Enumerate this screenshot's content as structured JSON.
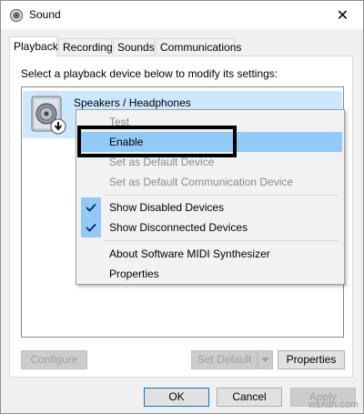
{
  "window": {
    "title": "Sound",
    "close_label": "✕"
  },
  "tabs": [
    {
      "label": "Playback",
      "active": true
    },
    {
      "label": "Recording",
      "active": false
    },
    {
      "label": "Sounds",
      "active": false
    },
    {
      "label": "Communications",
      "active": false
    }
  ],
  "playback": {
    "instruction": "Select a playback device below to modify its settings:",
    "devices": [
      {
        "name": "Speakers / Headphones",
        "icon": "speaker-icon",
        "status_icon": "down-arrow-icon"
      }
    ]
  },
  "context_menu": {
    "items": [
      {
        "label": "Test",
        "state": "disabled"
      },
      {
        "label": "Enable",
        "state": "highlighted"
      },
      {
        "label": "Set as Default Device",
        "state": "disabled"
      },
      {
        "label": "Set as Default Communication Device",
        "state": "disabled"
      },
      {
        "label": "Show Disabled Devices",
        "checked": true
      },
      {
        "label": "Show Disconnected Devices",
        "checked": true
      },
      {
        "label": "About Software MIDI Synthesizer"
      },
      {
        "label": "Properties"
      }
    ]
  },
  "panel_buttons": {
    "configure": "Configure",
    "set_default": "Set Default",
    "properties": "Properties"
  },
  "dialog_buttons": {
    "ok": "OK",
    "cancel": "Cancel",
    "apply": "Apply"
  },
  "watermark": "wsxdn.com",
  "colors": {
    "selection": "#cce8ff",
    "menu_highlight": "#91c9f7",
    "check_mark": "#0a246a",
    "annotation_box": "#000000"
  }
}
